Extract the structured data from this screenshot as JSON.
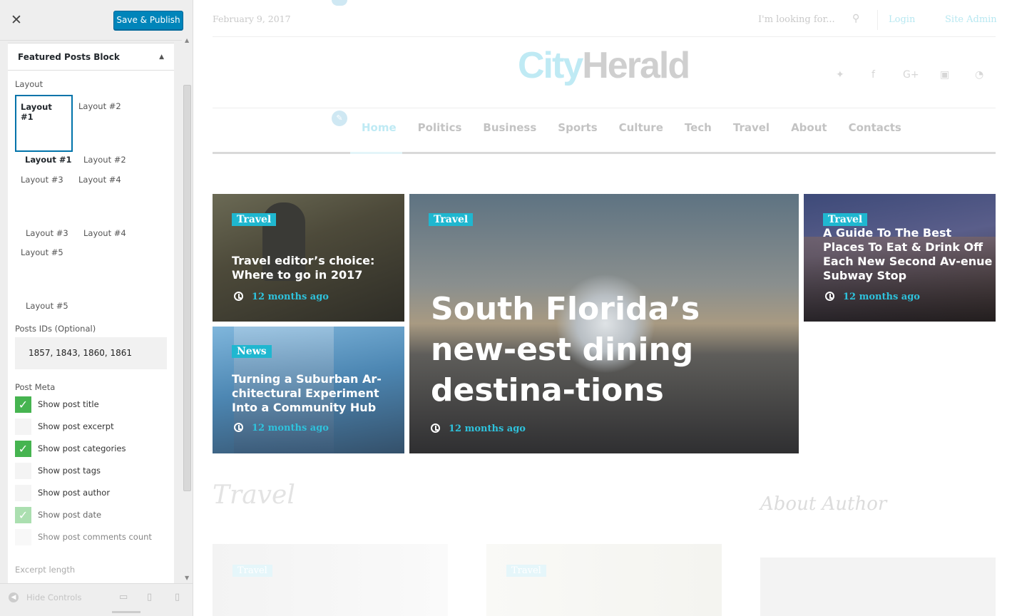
{
  "sidebar": {
    "close_glyph": "✕",
    "save_label": "Save & Publish",
    "panel_title": "Featured Posts Block",
    "layout_label": "Layout",
    "layout_selected": "Layout #1",
    "layout_option_2": "Layout #2",
    "layout_caption_1": "Layout #1",
    "layout_caption_2": "Layout #2",
    "layout_option_3": "Layout #3",
    "layout_option_4": "Layout #4",
    "layout_caption_3": "Layout #3",
    "layout_caption_4": "Layout #4",
    "layout_option_5": "Layout #5",
    "layout_caption_5": "Layout #5",
    "posts_ids_label": "Posts IDs (Optional)",
    "posts_ids_value": "1857, 1843, 1860, 1861",
    "post_meta_label": "Post Meta",
    "post_meta": [
      {
        "label": "Show post title",
        "checked": true
      },
      {
        "label": "Show post excerpt",
        "checked": false
      },
      {
        "label": "Show post categories",
        "checked": true
      },
      {
        "label": "Show post tags",
        "checked": false
      },
      {
        "label": "Show post author",
        "checked": false
      },
      {
        "label": "Show post date",
        "checked": true
      },
      {
        "label": "Show post comments count",
        "checked": false
      }
    ],
    "excerpt_length_label": "Excerpt length",
    "hide_controls_label": "Hide Controls"
  },
  "site": {
    "date": "February 9, 2017",
    "search_placeholder": "I'm looking for...",
    "login": "Login",
    "site_admin": "Site Admin",
    "logo_city": "City",
    "logo_herald": "Herald",
    "nav": [
      "Home",
      "Politics",
      "Business",
      "Sports",
      "Culture",
      "Tech",
      "Travel",
      "About",
      "Contacts"
    ],
    "nav_active": "Home",
    "cards": [
      {
        "category": "Travel",
        "title": "Travel editor’s choice: Where to go in 2017",
        "time": "12 months ago"
      },
      {
        "category": "News",
        "title": "Turning a Suburban Ar-chitectural Experiment Into a Community Hub",
        "time": "12 months ago"
      },
      {
        "category": "Travel",
        "title": "South Florida’s new-est dining destina-tions",
        "time": "12 months ago"
      },
      {
        "category": "Travel",
        "title": "A Guide To The Best Places To Eat & Drink Off Each New Second Av-enue Subway Stop",
        "time": "12 months ago"
      }
    ],
    "section_travel": "Travel",
    "section_author": "About Author",
    "faded_cat_1": "Travel",
    "faded_cat_2": "Travel"
  },
  "colors": {
    "accent": "#1fb7d0",
    "save_button": "#0085ba",
    "checkbox_on": "#46b450"
  }
}
